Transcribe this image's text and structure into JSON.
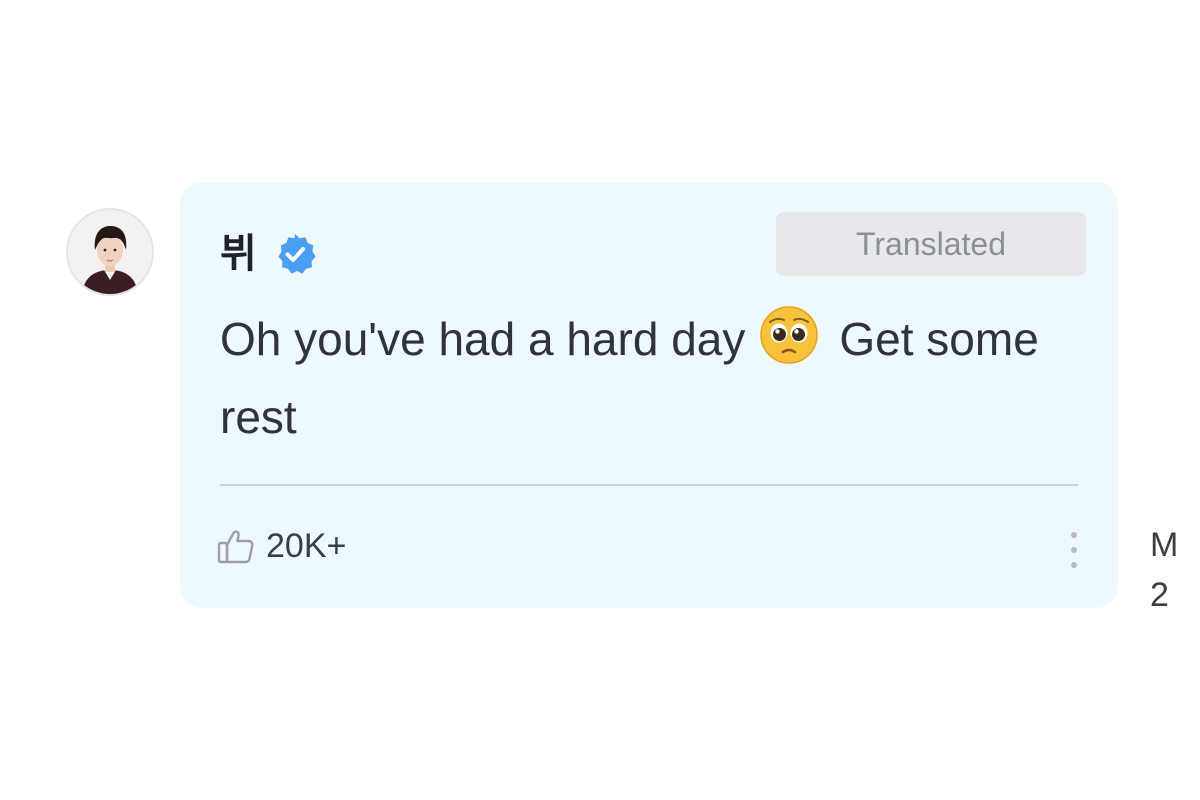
{
  "post": {
    "author": {
      "name": "뷔",
      "avatar_icon": "profile-photo",
      "verified_icon": "verified-badge-icon",
      "verified_color": "#4a9ff5"
    },
    "translated_label": "Translated",
    "message": {
      "before_emoji": "Oh you've had a hard day",
      "emoji_icon": "pleading-face-emoji",
      "after_emoji": "Get some rest"
    },
    "likes": {
      "icon": "thumbs-up-icon",
      "count": "20K+"
    },
    "more_icon": "vertical-dots-icon"
  },
  "meta": {
    "line1": "M",
    "line2": "2"
  },
  "colors": {
    "bubble_background": "#eef9fd",
    "divider": "#bcd9e6",
    "translated_background": "#e7e8eb",
    "translated_text": "#8b9097"
  }
}
